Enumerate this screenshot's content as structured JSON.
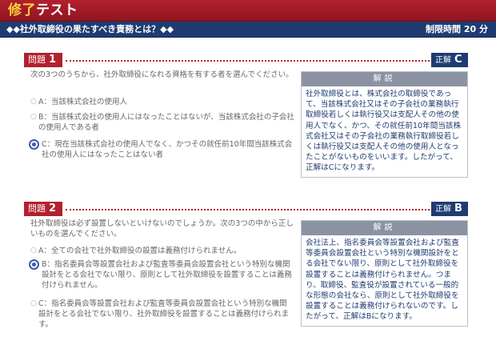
{
  "header": {
    "title_part1": "修了",
    "title_part2": "テスト",
    "subtitle": "◆◆社外取締役の果たすべき責務とは？◆◆",
    "time_limit": "制限時間 20 分"
  },
  "questions": [
    {
      "label": "問題",
      "number": "1",
      "answer_label": "正解",
      "answer": "C",
      "text": "次の3つのうちから、社外取締役になれる資格を有する者を選んでください。",
      "options": [
        {
          "id": "A",
          "mark": "○",
          "text": "A：当該株式会社の使用人",
          "selected": false
        },
        {
          "id": "B",
          "mark": "○",
          "text": "B：当該株式会社の使用人にはなったことはないが、当該株式会社の子会社の使用人である者",
          "selected": false
        },
        {
          "id": "C",
          "mark": "",
          "text": "C：現在当該株式会社の使用人でなく、かつその就任前10年間当該株式会社の使用人にはなったことはない者",
          "selected": true
        }
      ],
      "explanation_title": "解説",
      "explanation": "社外取締役とは、株式会社の取締役であって、当該株式会社又はその子会社の業務執行取締役若しくは執行役又は支配人その他の使用人でなく、かつ、その就任前10年間当該株式会社又はその子会社の業務執行取締役若しくは執行役又は支配人その他の使用人となったことがないものをいいます。したがって、正解はCになります。"
    },
    {
      "label": "問題",
      "number": "2",
      "answer_label": "正解",
      "answer": "B",
      "text": "社外取締役は必ず設置しないといけないのでしょうか。次の3つの中から正しいものを選んでください。",
      "options": [
        {
          "id": "A",
          "mark": "○",
          "text": "A：全ての会社で社外取締役の設置は義務付けられません。",
          "selected": false
        },
        {
          "id": "B",
          "mark": "",
          "text": "B：指名委員会等設置会社および監査等委員会設置会社という特別な機関設計をとる会社でない限り、原則として社外取締役を設置することは義務付けられません。",
          "selected": true
        },
        {
          "id": "C",
          "mark": "○",
          "text": "C：指名委員会等設置会社および監査等委員会設置会社という特別な機関設計をとる会社でない限り、社外取締役を設置することは義務付けられます。",
          "selected": false
        }
      ],
      "explanation_title": "解説",
      "explanation": "会社法上、指名委員会等設置会社および監査等委員会設置会社という特別な機関設計をとる会社でない限り、原則として社外取締役を設置することは義務付けられません。つまり、取締役、監査役が設置されている一般的な形態の会社なら、原則として社外取締役を設置することは義務付けられないのです。したがって、正解はBになります。"
    }
  ]
}
